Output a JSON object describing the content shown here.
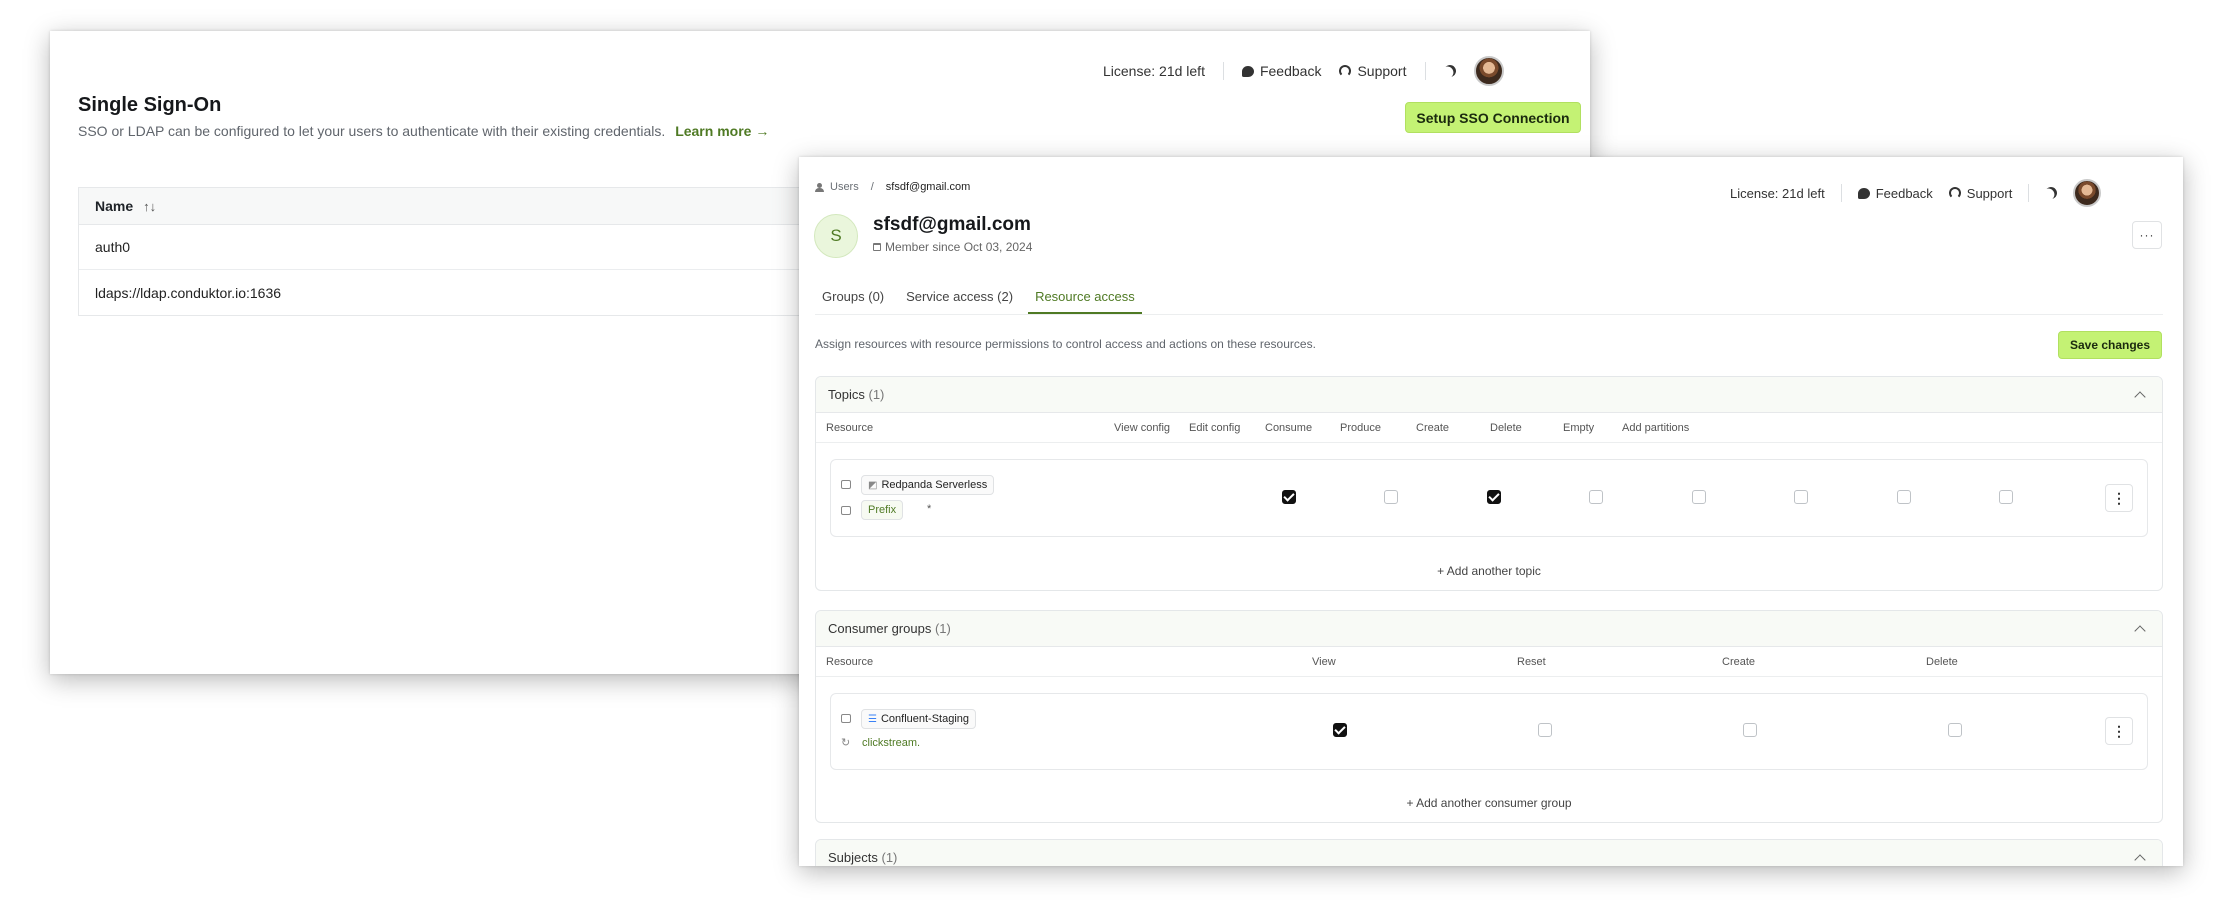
{
  "topbar": {
    "license": "License: 21d left",
    "feedback": "Feedback",
    "support": "Support"
  },
  "sso": {
    "title": "Single Sign-On",
    "description": "SSO or LDAP can be configured to let your users to authenticate with their existing credentials.",
    "learn_more": "Learn more →",
    "setup_button": "Setup SSO Connection",
    "table": {
      "name_header": "Name",
      "rows": [
        "auth0",
        "ldaps://ldap.conduktor.io:1636"
      ]
    }
  },
  "user": {
    "breadcrumb": {
      "parent": "Users",
      "separator": "/",
      "current": "sfsdf@gmail.com"
    },
    "avatar_letter": "S",
    "email": "sfsdf@gmail.com",
    "member_since": "Member since Oct 03, 2024",
    "more": "···",
    "tabs": [
      "Groups (0)",
      "Service access (2)",
      "Resource access"
    ],
    "description": "Assign resources with resource permissions to control access and actions on these resources.",
    "save_button": "Save changes",
    "topics": {
      "title": "Topics",
      "count": "(1)",
      "columns": [
        "Resource",
        "View config",
        "Edit config",
        "Consume",
        "Produce",
        "Create",
        "Delete",
        "Empty",
        "Add partitions"
      ],
      "cluster": "Redpanda Serverless",
      "pattern_type": "Prefix",
      "pattern": "*",
      "permissions": [
        true,
        false,
        true,
        false,
        false,
        false,
        false,
        false
      ],
      "add_link": "+ Add another topic"
    },
    "consumer_groups": {
      "title": "Consumer groups",
      "count": "(1)",
      "columns": [
        "Resource",
        "View",
        "Reset",
        "Create",
        "Delete"
      ],
      "cluster": "Confluent-Staging",
      "pattern": "clickstream.",
      "permissions": [
        true,
        false,
        false,
        false
      ],
      "add_link": "+ Add another consumer group"
    },
    "subjects": {
      "title": "Subjects",
      "count": "(1)"
    }
  },
  "colors": {
    "accent": "#c4f274",
    "accent_text": "#4f7a24"
  }
}
